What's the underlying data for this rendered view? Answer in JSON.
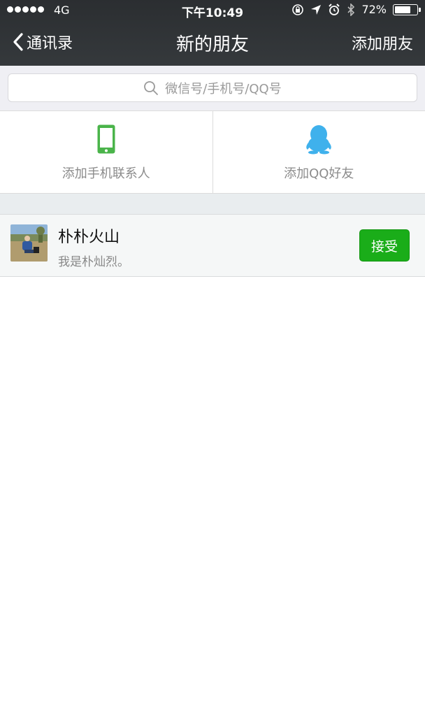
{
  "status_bar": {
    "carrier": "4G",
    "time": "下午10:49",
    "battery_percent": "72%",
    "battery_level": 0.72
  },
  "nav": {
    "back_label": "通讯录",
    "title": "新的朋友",
    "right_action": "添加朋友"
  },
  "search": {
    "placeholder": "微信号/手机号/QQ号"
  },
  "options": [
    {
      "label": "添加手机联系人",
      "icon": "phone-icon",
      "color": "#4ab44a"
    },
    {
      "label": "添加QQ好友",
      "icon": "qq-penguin-icon",
      "color": "#3fb1ec"
    }
  ],
  "requests": [
    {
      "name": "朴朴火山",
      "message": "我是朴灿烈。",
      "action": "接受"
    }
  ],
  "colors": {
    "accent_green": "#1aad19",
    "nav_bg": "#2f3235"
  }
}
